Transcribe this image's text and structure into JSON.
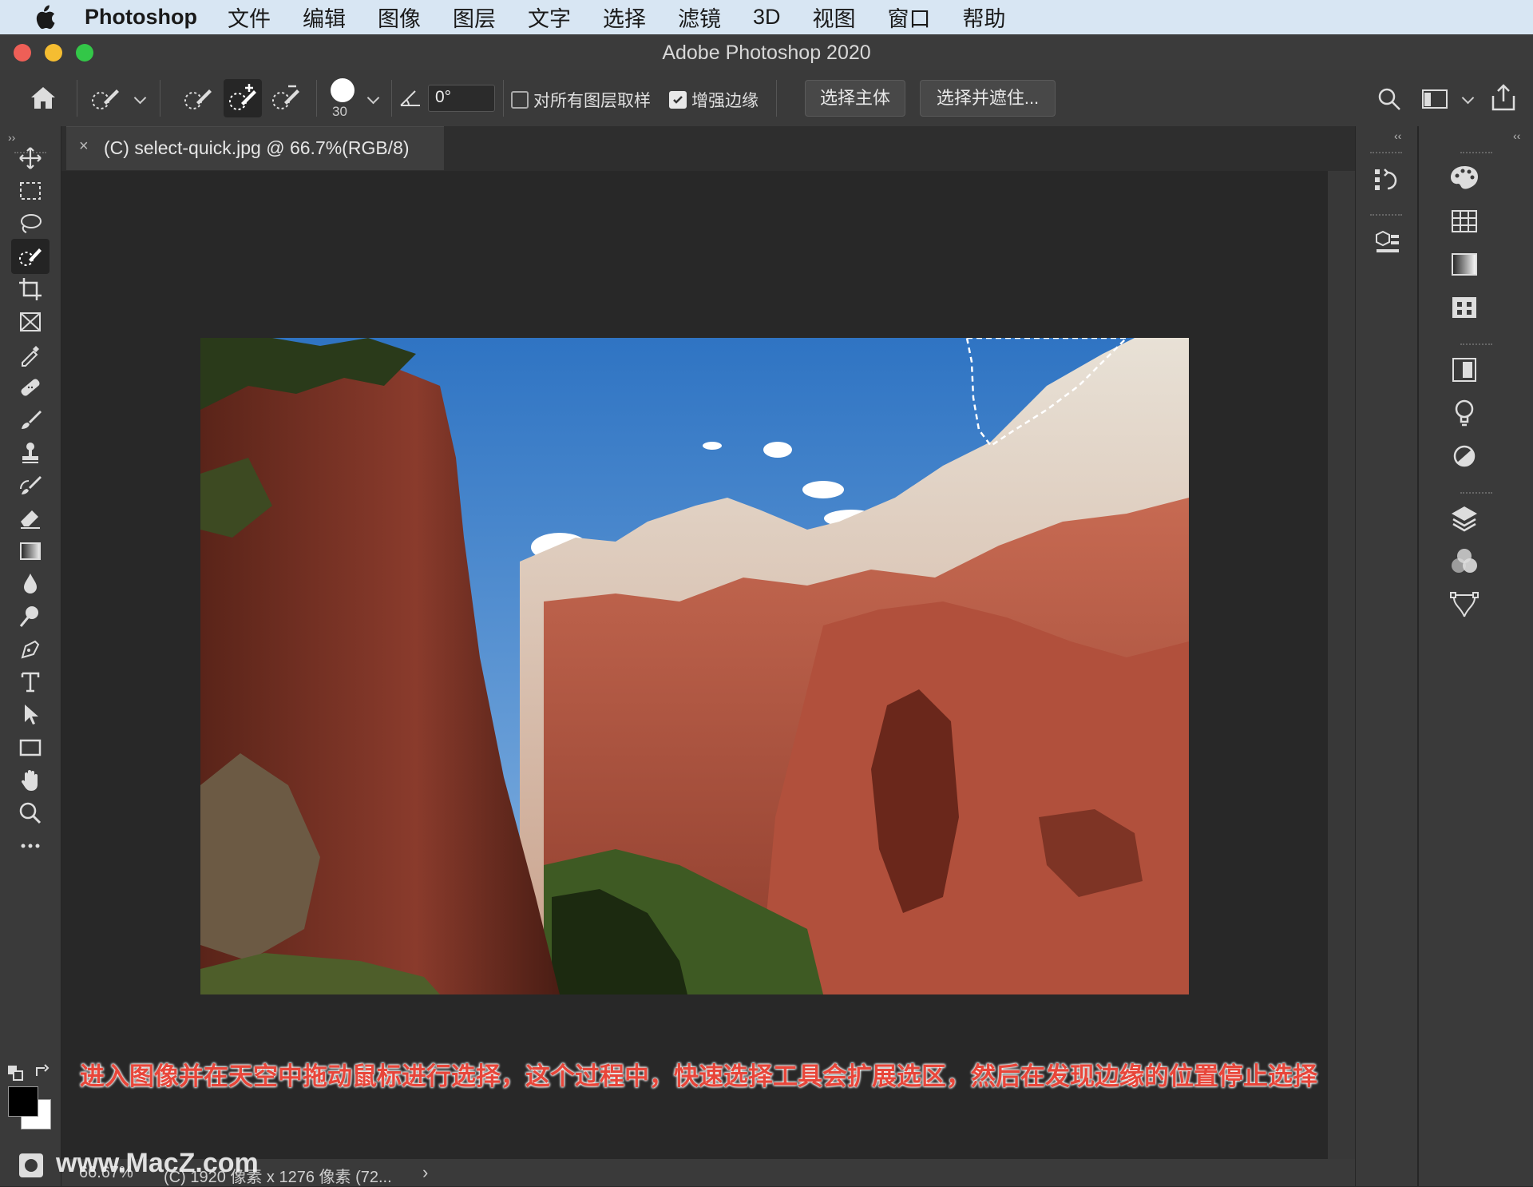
{
  "menubar": {
    "app_name": "Photoshop",
    "items": [
      "文件",
      "编辑",
      "图像",
      "图层",
      "文字",
      "选择",
      "滤镜",
      "3D",
      "视图",
      "窗口",
      "帮助"
    ]
  },
  "window": {
    "title": "Adobe Photoshop 2020"
  },
  "options": {
    "brush_size": "30",
    "angle_value": "0°",
    "sample_all_layers_label": "对所有图层取样",
    "sample_all_layers_checked": false,
    "enhance_edge_label": "增强边缘",
    "enhance_edge_checked": true,
    "select_subject_label": "选择主体",
    "select_and_mask_label": "选择并遮住..."
  },
  "document": {
    "tab_title": "(C) select-quick.jpg @ 66.7%(RGB/8)",
    "tab_close": "×"
  },
  "status": {
    "zoom": "66.67%",
    "info": "(C) 1920 像素 x 1276 像素 (72...",
    "arrow": "›"
  },
  "caption": "进入图像并在天空中拖动鼠标进行选择，这个过程中，快速选择工具会扩展选区，然后在发现边缘的位置停止选择",
  "watermark": "www.MacZ.com",
  "panel_collapse": {
    "left": "››",
    "right": "‹‹"
  },
  "tools_active": "quick-selection-tool",
  "colors": {
    "foreground": "#000000",
    "background": "#ffffff",
    "caption": "#e8463a"
  }
}
